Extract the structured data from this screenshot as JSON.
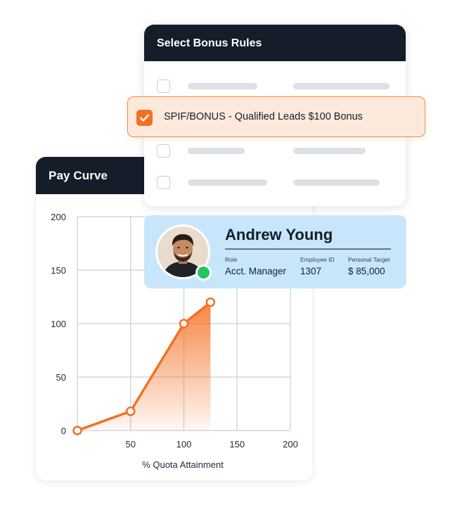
{
  "pay_curve": {
    "title": "Pay Curve",
    "chart_data": {
      "type": "area",
      "title": "Pay Curve",
      "xlabel": "% Quota Attainment",
      "ylabel": "",
      "x_ticks": [
        "50",
        "100",
        "150",
        "200"
      ],
      "y_ticks": [
        "0",
        "50",
        "100",
        "150",
        "200"
      ],
      "xlim": [
        0,
        200
      ],
      "ylim": [
        0,
        200
      ],
      "grid": true,
      "series": [
        {
          "x": [
            0,
            50,
            100,
            125
          ],
          "y": [
            0,
            18,
            100,
            120
          ]
        }
      ],
      "colors": {
        "line": "#f37021",
        "fill": "#f6a572",
        "grid": "#d4d7dc"
      }
    }
  },
  "bonus_rules": {
    "title": "Select Bonus Rules",
    "selected_rule": "SPIF/BONUS - Qualified Leads $100 Bonus",
    "accent": "#f37021"
  },
  "employee": {
    "name": "Andrew Young",
    "role_label": "Role",
    "role": "Acct. Manager",
    "id_label": "Employee ID",
    "id": "1307",
    "target_label": "Personal Target",
    "target": "$ 85,000",
    "status_color": "#22c55e",
    "icons": [
      "avatar",
      "online-status-icon",
      "checkbox-checked-icon"
    ]
  }
}
